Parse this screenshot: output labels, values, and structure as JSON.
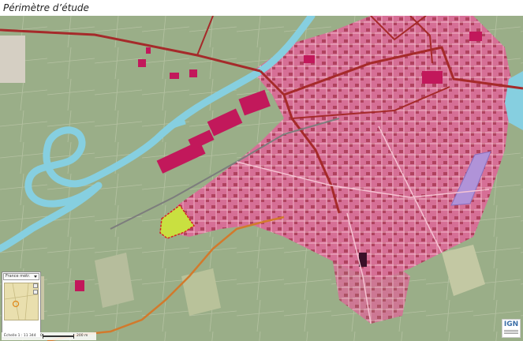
{
  "title": "Périmètre d’étude",
  "minimap": {
    "selected_option": "France métr."
  },
  "scale": {
    "ratio_text": "Échelle 1 : 11 344",
    "start_text": "0",
    "end_text": "200 m"
  },
  "attribution": {
    "logo_text": "IGN"
  },
  "colors": {
    "built_area": "#e36d9c",
    "major_road": "#a52a2a",
    "river": "#86cfe0",
    "farmland": "#9fb08d",
    "study_area_fill": "#c9e040",
    "study_area_border": "#d32424",
    "purple_zone": "#b093d8"
  }
}
